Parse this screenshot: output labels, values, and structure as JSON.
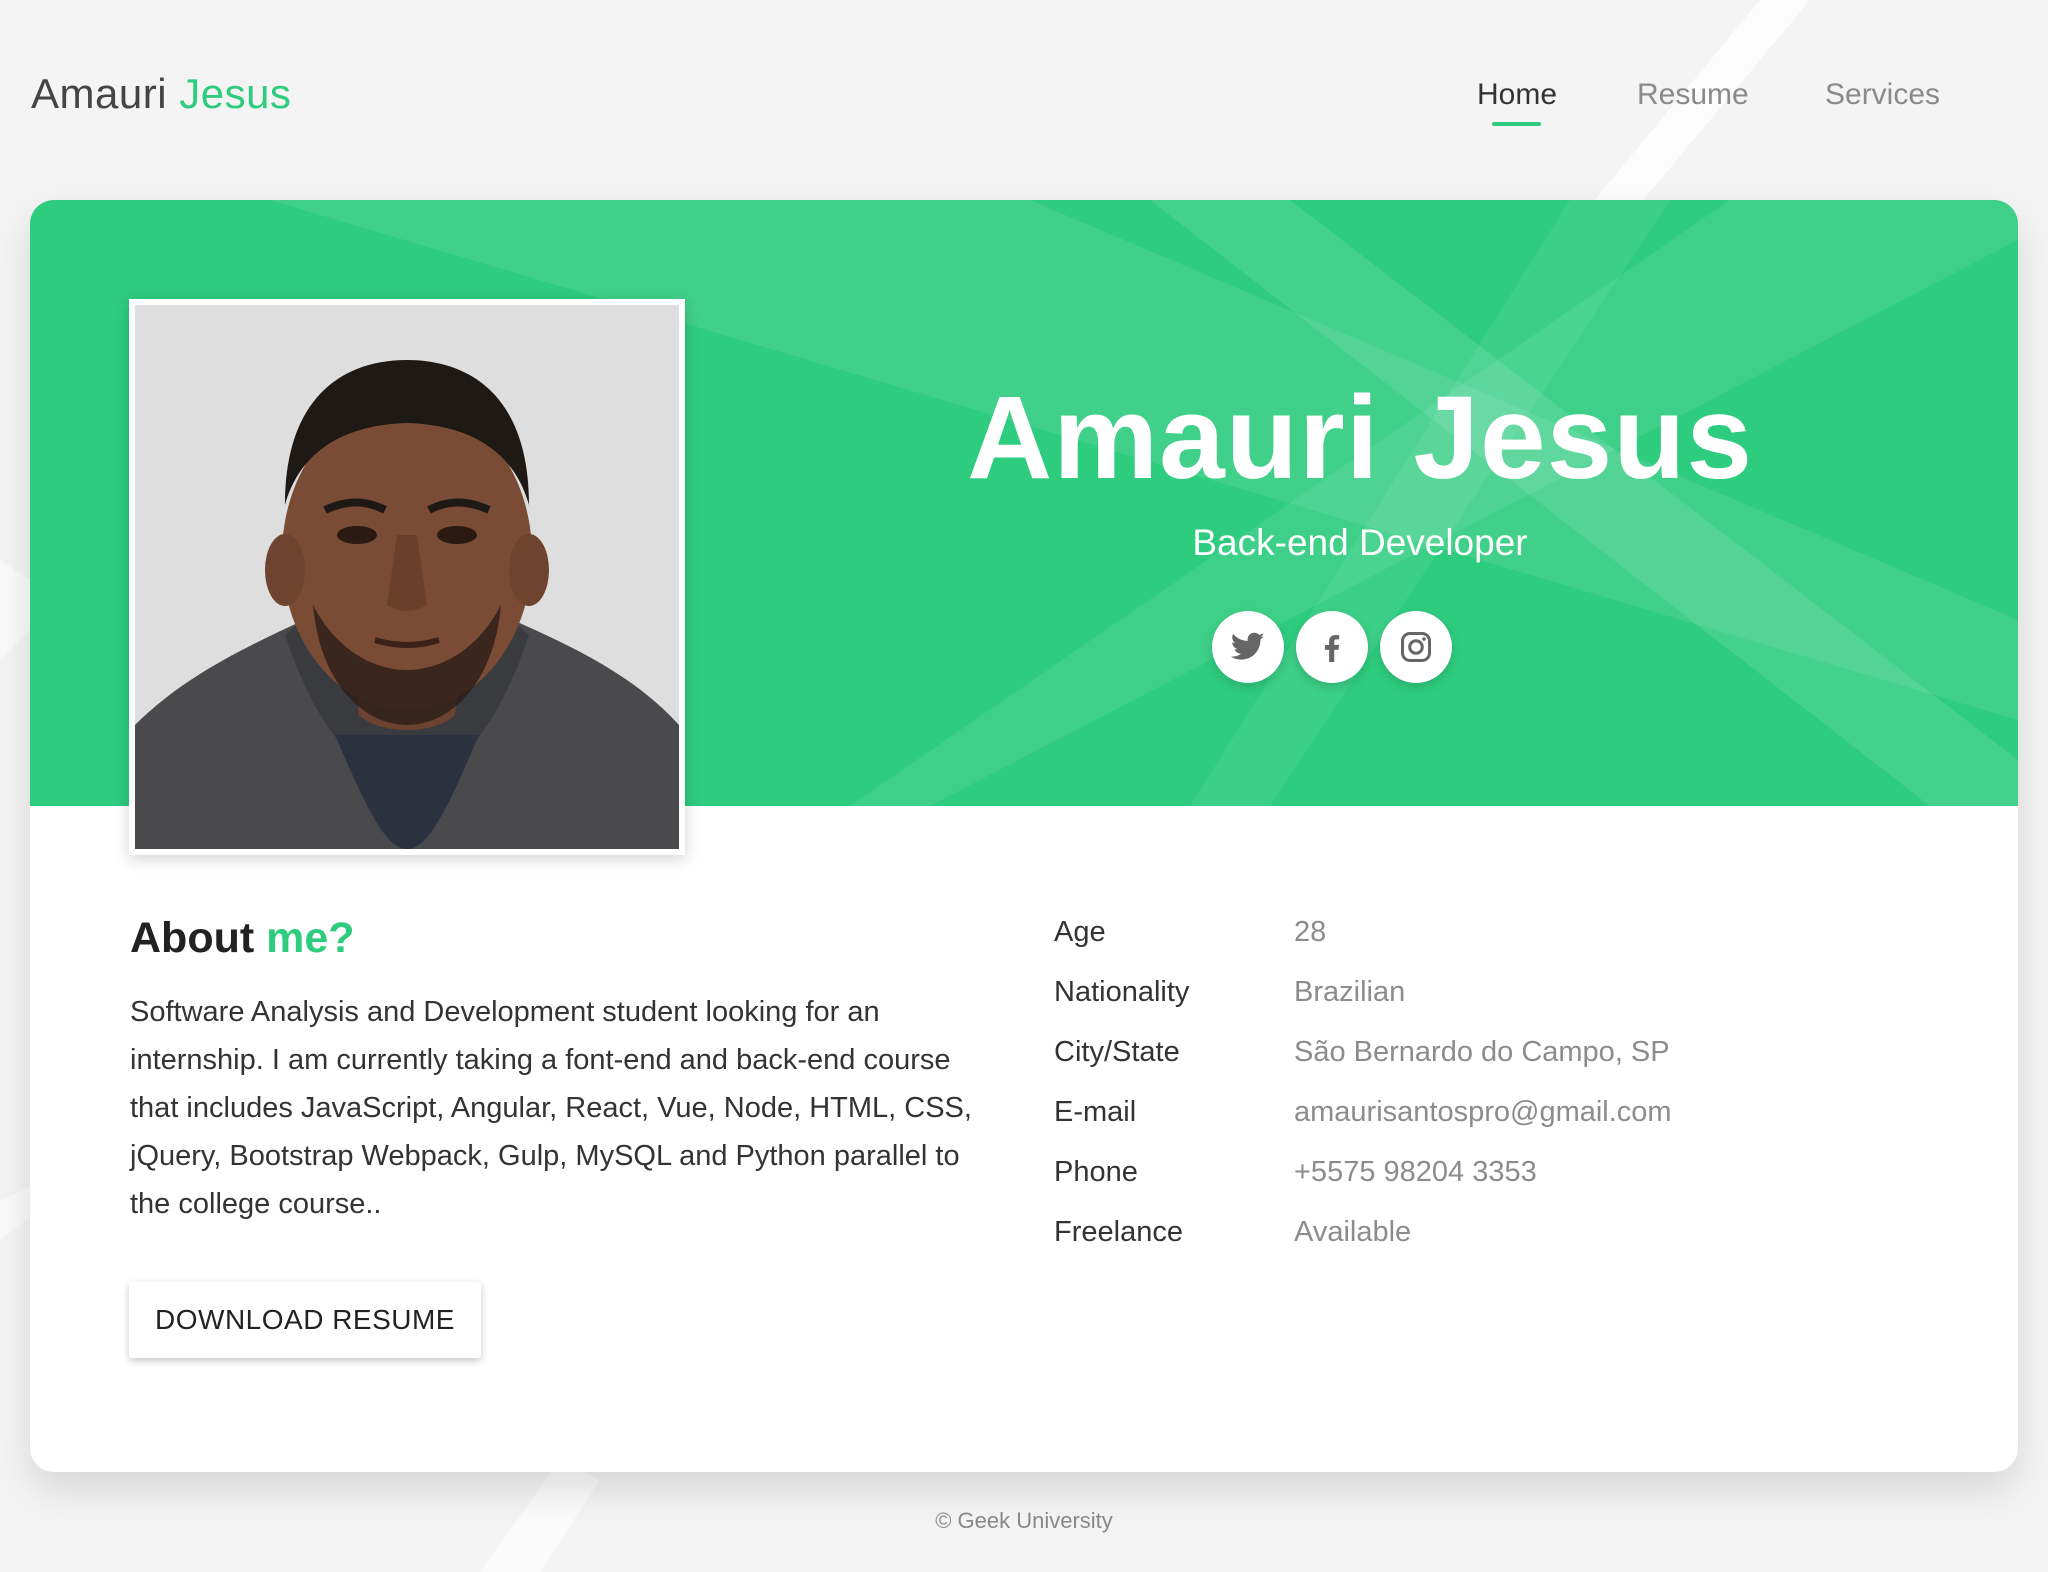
{
  "header": {
    "logo_first": "Amauri",
    "logo_second": "Jesus",
    "nav": [
      {
        "label": "Home",
        "active": true
      },
      {
        "label": "Resume",
        "active": false
      },
      {
        "label": "Services",
        "active": false
      }
    ]
  },
  "hero": {
    "name": "Amauri Jesus",
    "role": "Back-end Developer",
    "social": [
      "twitter-icon",
      "facebook-icon",
      "instagram-icon"
    ],
    "photo": "profile-photo"
  },
  "about": {
    "title_first": "About",
    "title_second": "me?",
    "text": "Software Analysis and Development student looking for an internship. I am currently taking a font-end and back-end course that includes JavaScript, Angular, React, Vue, Node, HTML, CSS, jQuery, Bootstrap Webpack, Gulp, MySQL and Python parallel to the college course..",
    "button_label": "DOWNLOAD RESUME"
  },
  "info": [
    {
      "label": "Age",
      "value": "28"
    },
    {
      "label": "Nationality",
      "value": "Brazilian"
    },
    {
      "label": "City/State",
      "value": "São Bernardo do Campo, SP"
    },
    {
      "label": "E-mail",
      "value": "amaurisantospro@gmail.com"
    },
    {
      "label": "Phone",
      "value": "+5575 98204 3353"
    },
    {
      "label": "Freelance",
      "value": "Available"
    }
  ],
  "footer": {
    "text": "© Geek University"
  },
  "colors": {
    "accent": "#2ecc7e",
    "background": "#f4f4f4",
    "card": "#ffffff"
  }
}
